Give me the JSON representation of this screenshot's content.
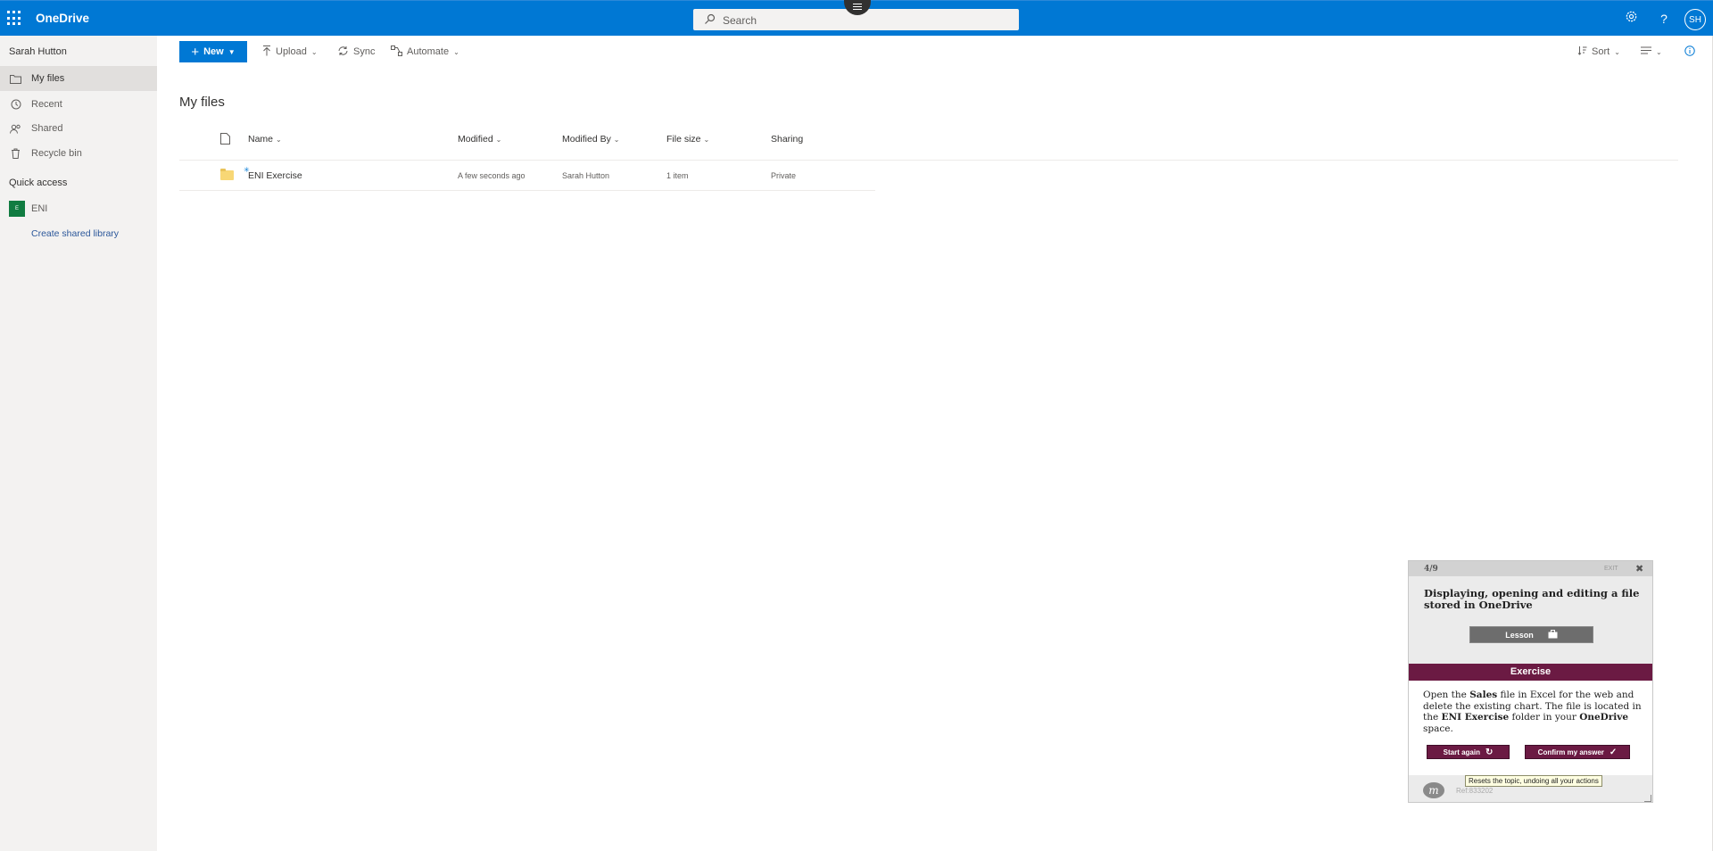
{
  "app": {
    "title": "OneDrive"
  },
  "search": {
    "placeholder": "Search"
  },
  "topbar": {
    "settings_icon": "gear-icon",
    "help_label": "?",
    "user_initials": "SH"
  },
  "sidebar": {
    "user_name": "Sarah Hutton",
    "items": [
      {
        "label": "My files",
        "icon": "folder-icon",
        "active": true
      },
      {
        "label": "Recent",
        "icon": "clock-icon",
        "active": false
      },
      {
        "label": "Shared",
        "icon": "people-icon",
        "active": false
      },
      {
        "label": "Recycle bin",
        "icon": "trash-icon",
        "active": false
      }
    ],
    "quick_access_label": "Quick access",
    "quick_access_items": [
      {
        "label": "ENI",
        "badge": "E"
      }
    ],
    "create_library_label": "Create shared library"
  },
  "commandbar": {
    "new_label": "New",
    "upload_label": "Upload",
    "sync_label": "Sync",
    "automate_label": "Automate",
    "sort_label": "Sort"
  },
  "main": {
    "title": "My files",
    "columns": [
      "Name",
      "Modified",
      "Modified By",
      "File size",
      "Sharing"
    ],
    "rows": [
      {
        "name": "ENI Exercise",
        "modified": "A few seconds ago",
        "modified_by": "Sarah Hutton",
        "size": "1 item",
        "sharing": "Private"
      }
    ]
  },
  "exercise_panel": {
    "step": "4/9",
    "exit_label": "EXIT",
    "title": "Displaying, opening and editing a file stored in OneDrive",
    "lesson_label": "Lesson",
    "exercise_label": "Exercise",
    "instruction": {
      "t1": "Open the ",
      "b1": "Sales",
      "t2": " file in Excel for the web and delete the existing chart. The file is located in the ",
      "b2": "ENI Exercise",
      "t3": " folder in your ",
      "b3": "OneDrive",
      "t4": " space."
    },
    "start_again_label": "Start again",
    "confirm_label": "Confirm my answer",
    "tooltip": "Resets the topic, undoing all your actions",
    "logo_letter": "m",
    "ref": "Ref:833202"
  },
  "colors": {
    "brand": "#0078d4",
    "exercise": "#6b1a43",
    "nav_bg": "#f3f2f1"
  }
}
